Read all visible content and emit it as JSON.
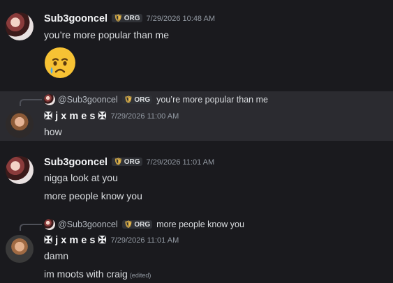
{
  "messages": [
    {
      "author": "Sub3gooncel",
      "tag": "ORG",
      "time": "7/29/2026 10:48 AM",
      "lines": [
        "you’re more popular than me"
      ],
      "emoji": "crying-face"
    },
    {
      "author": "✠ j x m e s ✠",
      "time": "7/29/2026 11:00 AM",
      "reply": {
        "user": "@Sub3gooncel",
        "tag": "ORG",
        "text": "you’re more popular than me"
      },
      "lines": [
        "how"
      ]
    },
    {
      "author": "Sub3gooncel",
      "tag": "ORG",
      "time": "7/29/2026 11:01 AM",
      "lines": [
        "nigga look at you",
        "more people know you"
      ]
    },
    {
      "author": "✠ j x m e s ✠",
      "time": "7/29/2026 11:01 AM",
      "reply": {
        "user": "@Sub3gooncel",
        "tag": "ORG",
        "text": "more people know you"
      },
      "lines": [
        "damn",
        "im moots with craig"
      ],
      "edited_label": "(edited)"
    }
  ],
  "colors": {
    "background": "#1a1a1e",
    "highlight": "#2b2b30",
    "org_shield": "#e7b84a"
  }
}
